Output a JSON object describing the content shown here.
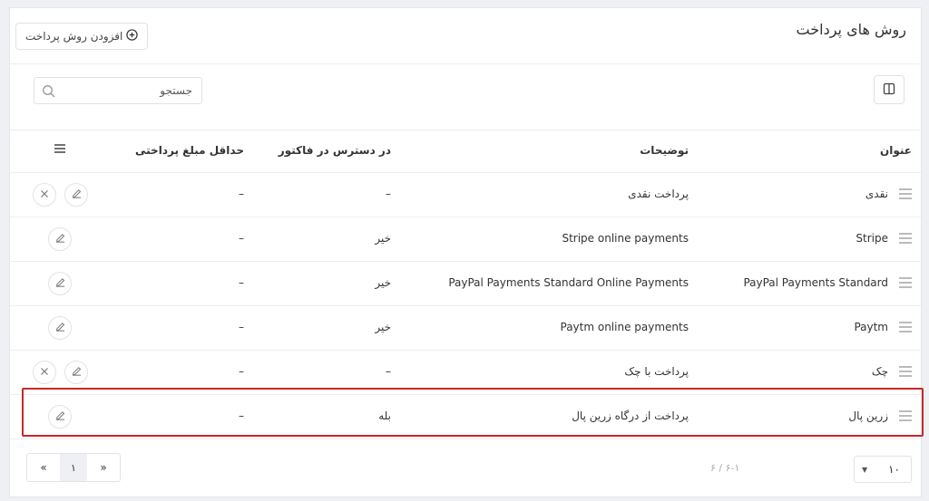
{
  "header": {
    "title": "روش های پرداخت",
    "add_button_label": "افزودن روش پرداخت"
  },
  "toolbar": {
    "search_placeholder": "جستجو"
  },
  "table": {
    "columns": {
      "title": "عنوان",
      "description": "توضیحات",
      "available_in_invoice": "در دسترس در فاکتور",
      "min_payment": "حداقل مبلغ پرداختی"
    },
    "rows": [
      {
        "title": "نقدی",
        "description": "پرداخت نقدی",
        "available_in_invoice": "–",
        "min_payment": "–",
        "can_delete": true
      },
      {
        "title": "Stripe",
        "description": "Stripe online payments",
        "available_in_invoice": "خیر",
        "min_payment": "–",
        "can_delete": false
      },
      {
        "title": "PayPal Payments Standard",
        "description": "PayPal Payments Standard Online Payments",
        "available_in_invoice": "خیر",
        "min_payment": "–",
        "can_delete": false
      },
      {
        "title": "Paytm",
        "description": "Paytm online payments",
        "available_in_invoice": "خیر",
        "min_payment": "–",
        "can_delete": false
      },
      {
        "title": "چک",
        "description": "پرداخت با چک",
        "available_in_invoice": "–",
        "min_payment": "–",
        "can_delete": true
      },
      {
        "title": "زرین پال",
        "description": "پرداخت از درگاه زرین پال",
        "available_in_invoice": "بله",
        "min_payment": "–",
        "can_delete": false
      }
    ]
  },
  "footer": {
    "page_size": "۱۰",
    "range_info": "۶-۱ / ۶",
    "current_page": "۱",
    "prev_label": "«",
    "next_label": "»"
  },
  "colors": {
    "highlight_border": "#c62828",
    "background": "#eef0f4"
  }
}
